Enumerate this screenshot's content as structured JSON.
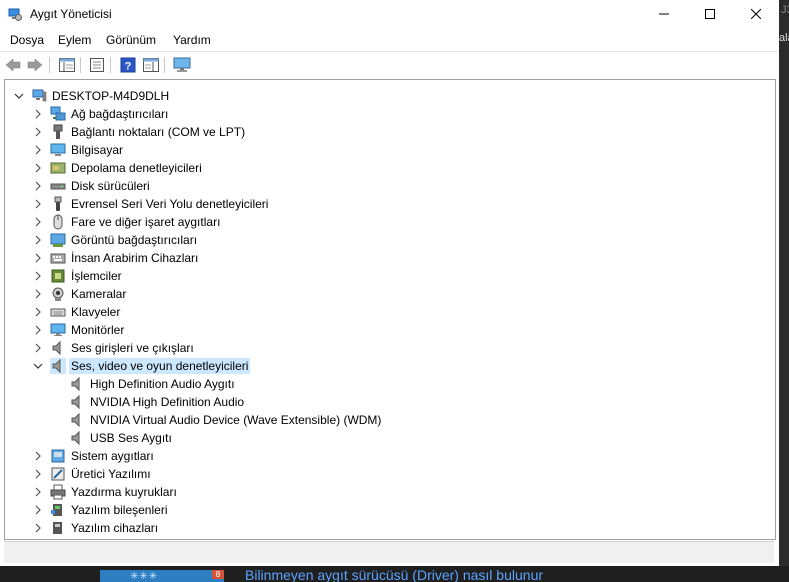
{
  "window": {
    "title": "Aygıt Yöneticisi"
  },
  "menu": [
    "Dosya",
    "Eylem",
    "Görünüm",
    "Yardım"
  ],
  "tree": {
    "root": "DESKTOP-M4D9DLH",
    "categories": [
      {
        "label": "Ağ bağdaştırıcıları",
        "icon": "network-adapter-icon"
      },
      {
        "label": "Bağlantı noktaları (COM ve LPT)",
        "icon": "port-icon"
      },
      {
        "label": "Bilgisayar",
        "icon": "computer-icon"
      },
      {
        "label": "Depolama denetleyicileri",
        "icon": "storage-controller-icon"
      },
      {
        "label": "Disk sürücüleri",
        "icon": "disk-drive-icon"
      },
      {
        "label": "Evrensel Seri Veri Yolu denetleyicileri",
        "icon": "usb-controller-icon"
      },
      {
        "label": "Fare ve diğer işaret aygıtları",
        "icon": "mouse-icon"
      },
      {
        "label": "Görüntü bağdaştırıcıları",
        "icon": "display-adapter-icon"
      },
      {
        "label": "İnsan Arabirim Cihazları",
        "icon": "hid-icon"
      },
      {
        "label": "İşlemciler",
        "icon": "processor-icon"
      },
      {
        "label": "Kameralar",
        "icon": "camera-icon"
      },
      {
        "label": "Klavyeler",
        "icon": "keyboard-icon"
      },
      {
        "label": "Monitörler",
        "icon": "monitor-icon"
      },
      {
        "label": "Ses girişleri ve çıkışları",
        "icon": "audio-io-icon"
      },
      {
        "label": "Ses, video ve oyun denetleyicileri",
        "icon": "sound-controller-icon",
        "expanded": true,
        "selected": true
      },
      {
        "label": "Sistem aygıtları",
        "icon": "system-devices-icon"
      },
      {
        "label": "Üretici Yazılımı",
        "icon": "firmware-icon"
      },
      {
        "label": "Yazdırma kuyrukları",
        "icon": "print-queue-icon"
      },
      {
        "label": "Yazılım bileşenleri",
        "icon": "software-component-icon"
      },
      {
        "label": "Yazılım cihazları",
        "icon": "software-device-icon"
      }
    ],
    "sound_children": [
      "High Definition Audio Aygıtı",
      "NVIDIA High Definition Audio",
      "NVIDIA Virtual Audio Device (Wave Extensible) (WDM)",
      "USB Ses Aygıtı"
    ]
  },
  "background": {
    "link_text": "Bilinmeyen aygıt sürücüsü (Driver) nasıl bulunur",
    "thumb_badge": "8",
    "edge_text": "ala",
    "edge_text2": "J3"
  },
  "colors": {
    "selection": "#cce8ff",
    "link": "#5ba3ff"
  }
}
